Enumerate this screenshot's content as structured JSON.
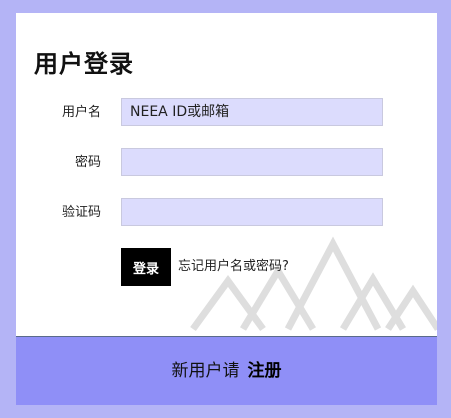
{
  "login": {
    "title": "用户登录",
    "username_label": "用户名",
    "username_placeholder": "NEEA ID或邮箱",
    "password_label": "密码",
    "captcha_label": "验证码",
    "submit_label": "登录",
    "forgot_link": "忘记用户名或密码?"
  },
  "footer": {
    "prompt": "新用户请",
    "register_link": "注册"
  },
  "colors": {
    "page_background": "#b4b4f6",
    "input_background": "#dcdcfd",
    "footer_background": "#8f8ff7",
    "button_background": "#000000"
  }
}
